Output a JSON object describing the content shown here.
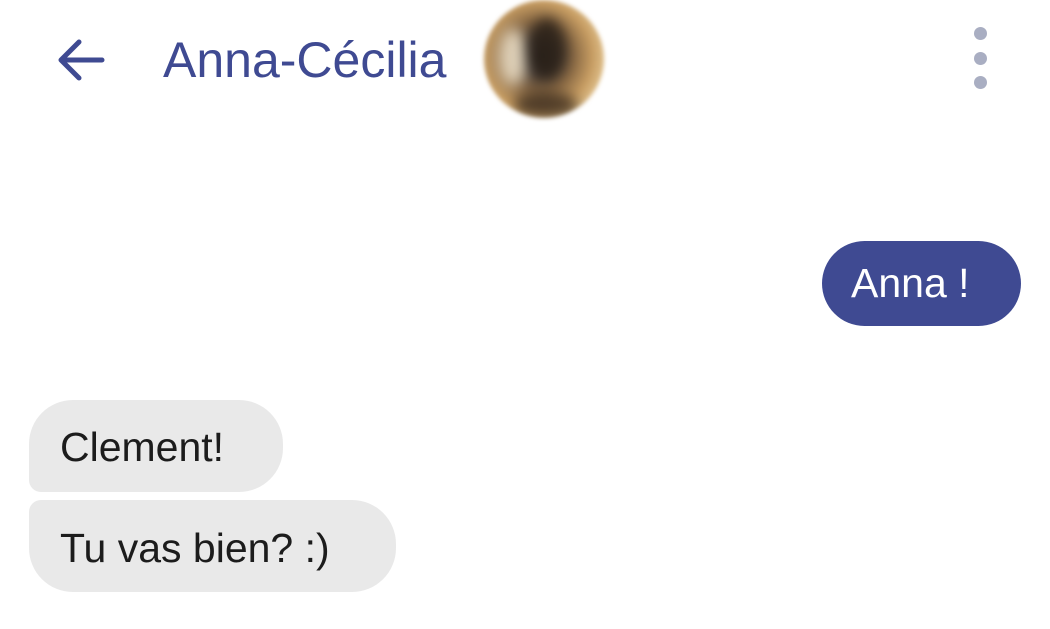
{
  "header": {
    "contact_name": "Anna-Cécilia",
    "back_icon": "arrow-left-icon",
    "menu_icon": "more-vertical-icon",
    "accent_color": "#3f4a92"
  },
  "messages": [
    {
      "direction": "outgoing",
      "text": "Anna !"
    },
    {
      "direction": "incoming",
      "text": "Clement!"
    },
    {
      "direction": "incoming",
      "text": "Tu vas bien? :)"
    }
  ],
  "colors": {
    "outgoing_bubble": "#3f4a92",
    "incoming_bubble": "#e9e9e9",
    "menu_dots": "#a9aec2"
  }
}
